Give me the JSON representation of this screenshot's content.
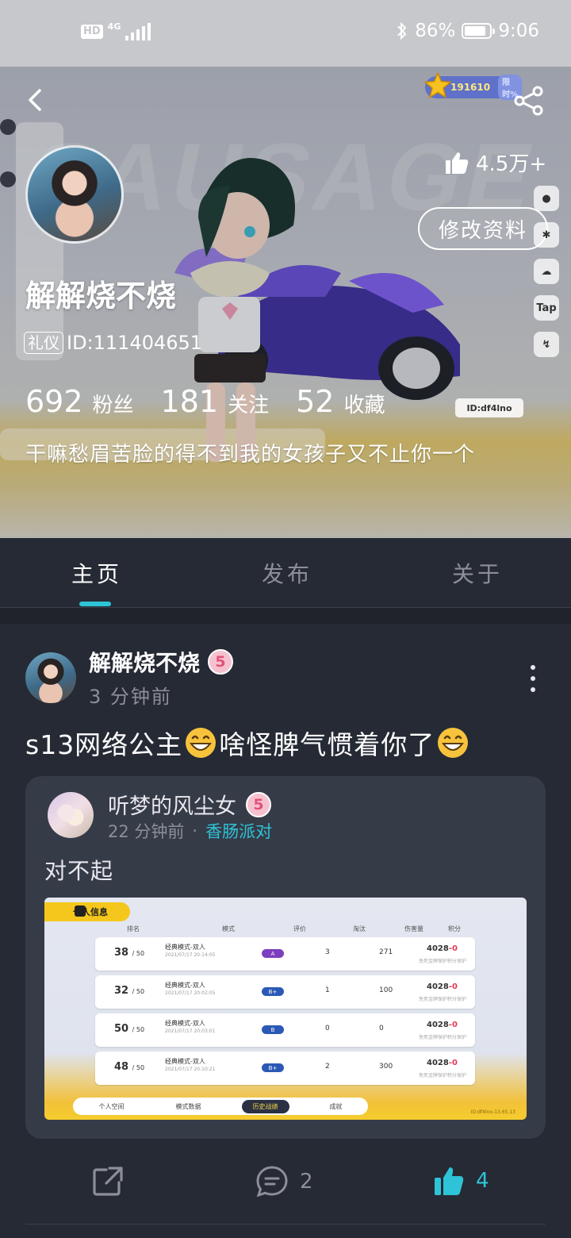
{
  "status_bar": {
    "hd": "HD",
    "network": "4G",
    "battery": "86%",
    "battery_level": 0.86,
    "time": "9:06"
  },
  "hero": {
    "coin_value": "191610",
    "coin_extra": "限时%",
    "likes": "4.5万+",
    "edit_button": "修改资料",
    "username": "解解烧不烧",
    "tag": "礼仪",
    "id_text": "ID:111404651",
    "game_id_tag": "ID:df4lno",
    "stats": [
      {
        "num": "692",
        "label": "粉丝"
      },
      {
        "num": "181",
        "label": "关注"
      },
      {
        "num": "52",
        "label": "收藏"
      }
    ],
    "bio": "干嘛愁眉苦脸的得不到我的女孩子又不止你一个",
    "side_icons": [
      "paw-icon",
      "gear-icon",
      "cloud-icon",
      "tap-icon",
      "share-node-icon"
    ]
  },
  "tabs": [
    {
      "label": "主页",
      "active": true
    },
    {
      "label": "发布",
      "active": false
    },
    {
      "label": "关于",
      "active": false
    }
  ],
  "post": {
    "author": "解解烧不烧",
    "level": "5",
    "time": "3 分钟前",
    "text_part1": "s13网络公主",
    "text_part2": "啥怪脾气惯着你了",
    "repost": {
      "author": "听梦的风尘女",
      "level": "5",
      "time": "22 分钟前",
      "dot": "·",
      "topic": "香肠派对",
      "text": "对不起",
      "screenshot": {
        "header": "个人信息",
        "columns": [
          "排名",
          "模式",
          "评价",
          "淘汰",
          "伤害量",
          "积分"
        ],
        "rows": [
          {
            "rank": "38",
            "total": "/ 50",
            "mode": "经典模式-双人",
            "mode_sub": "2021/07/17 20:14:05",
            "grade": "A",
            "grade_color": "#7b3fbf",
            "kills": "3",
            "damage": "271",
            "score": "4028",
            "delta": "-0",
            "score_sub": "免死金牌保护积分保护"
          },
          {
            "rank": "32",
            "total": "/ 50",
            "mode": "经典模式-双人",
            "mode_sub": "2021/07/17 20:02:05",
            "grade": "B+",
            "grade_color": "#2b59b5",
            "kills": "1",
            "damage": "100",
            "score": "4028",
            "delta": "-0",
            "score_sub": "免死金牌保护积分保护"
          },
          {
            "rank": "50",
            "total": "/ 50",
            "mode": "经典模式-双人",
            "mode_sub": "2021/07/17 20:03:01",
            "grade": "B",
            "grade_color": "#2b59b5",
            "kills": "0",
            "damage": "0",
            "score": "4028",
            "delta": "-0",
            "score_sub": "免死金牌保护积分保护"
          },
          {
            "rank": "48",
            "total": "/ 50",
            "mode": "经典模式-双人",
            "mode_sub": "2021/07/17 20:10:21",
            "grade": "B+",
            "grade_color": "#2b59b5",
            "kills": "2",
            "damage": "300",
            "score": "4028",
            "delta": "-0",
            "score_sub": "免死金牌保护积分保护"
          }
        ],
        "tabs": [
          "个人空间",
          "模式数据",
          "历史战绩",
          "成就"
        ],
        "active_tab": 2,
        "footer": "ID:df4lno-13.65.13"
      }
    },
    "actions": {
      "comments": "2",
      "likes": "4"
    }
  },
  "colors": {
    "accent": "#2ec3d6",
    "background": "#262a35",
    "card": "#363b48",
    "badge_pink": "#f6c1cf"
  }
}
